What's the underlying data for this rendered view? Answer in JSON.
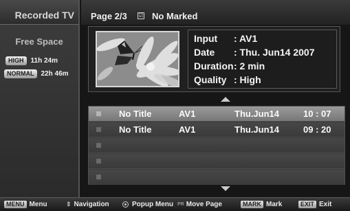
{
  "sidebar": {
    "title": "Recorded TV",
    "free_space_label": "Free Space",
    "space": [
      {
        "badge": "HIGH",
        "value": "11h 24m"
      },
      {
        "badge": "NORMAL",
        "value": "22h 46m"
      }
    ]
  },
  "header": {
    "page": "Page 2/3",
    "mark_icon": "☑",
    "marked_status": "No Marked"
  },
  "info": {
    "input_key": "Input",
    "input_val": ": AV1",
    "date_key": "Date",
    "date_val": ": Thu. Jun14 2007",
    "duration_key": "Duration",
    "duration_val": ": 2 min",
    "quality_key": "Quality",
    "quality_val": ": High"
  },
  "recordings": [
    {
      "title": "No Title",
      "source": "AV1",
      "date": "Thu.Jun14",
      "time": "10 : 07",
      "selected": true
    },
    {
      "title": "No Title",
      "source": "AV1",
      "date": "Thu.Jun14",
      "time": "09 : 20",
      "selected": false
    },
    {
      "title": "",
      "source": "",
      "date": "",
      "time": "",
      "selected": false
    },
    {
      "title": "",
      "source": "",
      "date": "",
      "time": "",
      "selected": false
    },
    {
      "title": "",
      "source": "",
      "date": "",
      "time": "",
      "selected": false
    }
  ],
  "footer": {
    "menu_key": "MENU",
    "menu_label": "Menu",
    "nav_icon": "⇕",
    "nav_label": "Navigation",
    "popup_label": "Popup Menu",
    "pr_icon": "PR",
    "move_label": "Move Page",
    "mark_key": "MARK",
    "mark_label": "Mark",
    "exit_key": "EXIT",
    "exit_label": "Exit"
  },
  "colors": {
    "background": "#161616",
    "selected_row": "#8a8a8a",
    "row": "#3f3f3f"
  }
}
